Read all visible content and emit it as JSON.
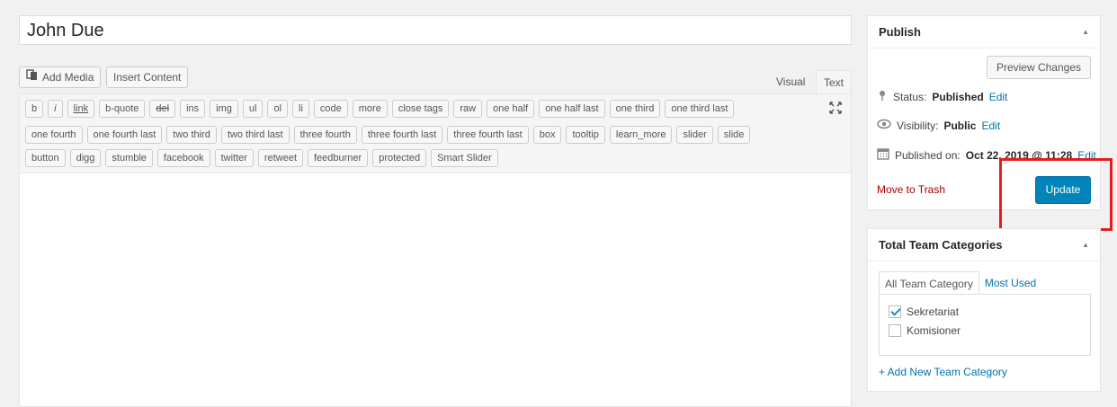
{
  "post": {
    "title": "John Due"
  },
  "editor": {
    "add_media_label": "Add Media",
    "insert_content_label": "Insert Content",
    "tab_visual": "Visual",
    "tab_text": "Text",
    "quicktags_row1": [
      "b",
      "i",
      "link",
      "b-quote",
      "del",
      "ins",
      "img",
      "ul",
      "ol",
      "li",
      "code",
      "more",
      "close tags",
      "raw",
      "one half",
      "one half last",
      "one third",
      "one third last"
    ],
    "quicktags_row2": [
      "one fourth",
      "one fourth last",
      "two third",
      "two third last",
      "three fourth",
      "three fourth last",
      "three fourth last",
      "box",
      "tooltip",
      "learn_more",
      "slider",
      "slide"
    ],
    "quicktags_row3": [
      "button",
      "digg",
      "stumble",
      "facebook",
      "twitter",
      "retweet",
      "feedburner",
      "protected",
      "Smart Slider"
    ],
    "content": ""
  },
  "publish": {
    "title": "Publish",
    "preview_label": "Preview Changes",
    "status_label": "Status:",
    "status_value": "Published",
    "status_edit": "Edit",
    "visibility_label": "Visibility:",
    "visibility_value": "Public",
    "visibility_edit": "Edit",
    "published_label": "Published on:",
    "published_value": "Oct 22, 2019 @ 11:28",
    "published_edit": "Edit",
    "trash_label": "Move to Trash",
    "update_label": "Update",
    "accent_color": "#0085ba",
    "highlight_color": "#e51c23"
  },
  "categories": {
    "title": "Total Team Categories",
    "tab_all": "All Team Category",
    "tab_most_used": "Most Used",
    "items": [
      {
        "label": "Sekretariat",
        "checked": true
      },
      {
        "label": "Komisioner",
        "checked": false
      }
    ],
    "add_new_label": "+ Add New Team Category"
  }
}
